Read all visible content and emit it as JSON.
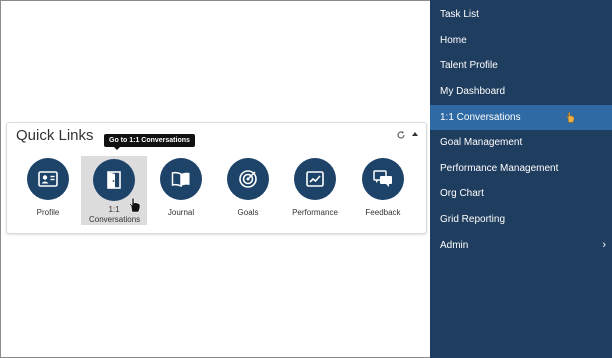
{
  "quick_links": {
    "title": "Quick Links",
    "tooltip": "Go to 1:1 Conversations",
    "items": [
      {
        "label": "Profile",
        "icon": "profile-card-icon"
      },
      {
        "label": "1:1 Conversations",
        "icon": "door-icon"
      },
      {
        "label": "Journal",
        "icon": "journal-icon"
      },
      {
        "label": "Goals",
        "icon": "target-icon"
      },
      {
        "label": "Performance",
        "icon": "trend-chart-icon"
      },
      {
        "label": "Feedback",
        "icon": "chat-icon"
      }
    ]
  },
  "sidebar": {
    "items": [
      {
        "label": "Task List"
      },
      {
        "label": "Home"
      },
      {
        "label": "Talent Profile"
      },
      {
        "label": "My Dashboard"
      },
      {
        "label": "1:1 Conversations"
      },
      {
        "label": "Goal Management"
      },
      {
        "label": "Performance Management"
      },
      {
        "label": "Org Chart"
      },
      {
        "label": "Grid Reporting"
      },
      {
        "label": "Admin"
      }
    ],
    "active_index": 4
  },
  "colors": {
    "sidebar_bg": "#1f3d5e",
    "sidebar_active": "#2f6aa4",
    "icon_circle": "#1d4369"
  }
}
